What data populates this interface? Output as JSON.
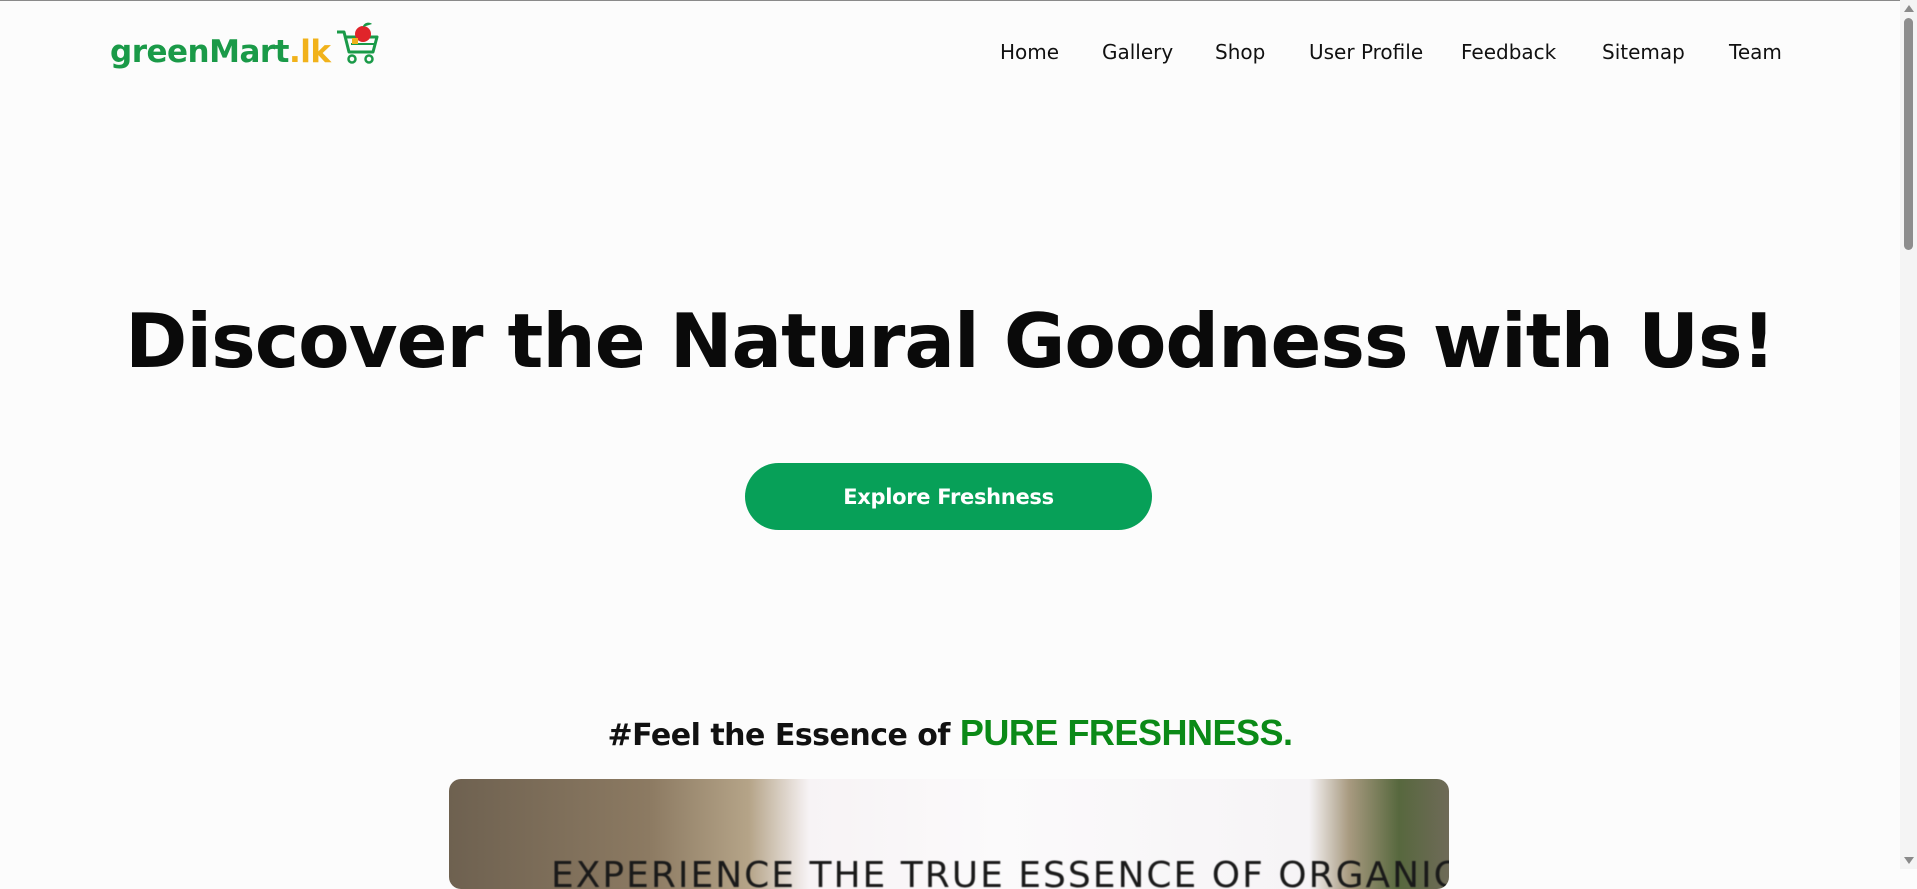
{
  "logo": {
    "green_part": "greenMart",
    "yellow_part": ".lk",
    "icon": "shopping-cart-icon"
  },
  "nav": [
    {
      "label": "Home"
    },
    {
      "label": "Gallery"
    },
    {
      "label": "Shop"
    },
    {
      "label": "User Profile"
    },
    {
      "label": "Feedback"
    },
    {
      "label": "Sitemap"
    },
    {
      "label": "Team"
    }
  ],
  "hero": {
    "title": "Discover the Natural Goodness with Us!",
    "cta_label": "Explore Freshness"
  },
  "tagline": {
    "prefix": "#Feel the Essence of ",
    "highlight": "PURE FRESHNESS."
  },
  "banner": {
    "text": "EXPERIENCE THE TRUE ESSENCE OF ORGANIC"
  },
  "colors": {
    "brand_green": "#1a9a48",
    "brand_yellow": "#f1b21b",
    "cta_green": "#07a058",
    "highlight_green": "#0b8a17"
  }
}
